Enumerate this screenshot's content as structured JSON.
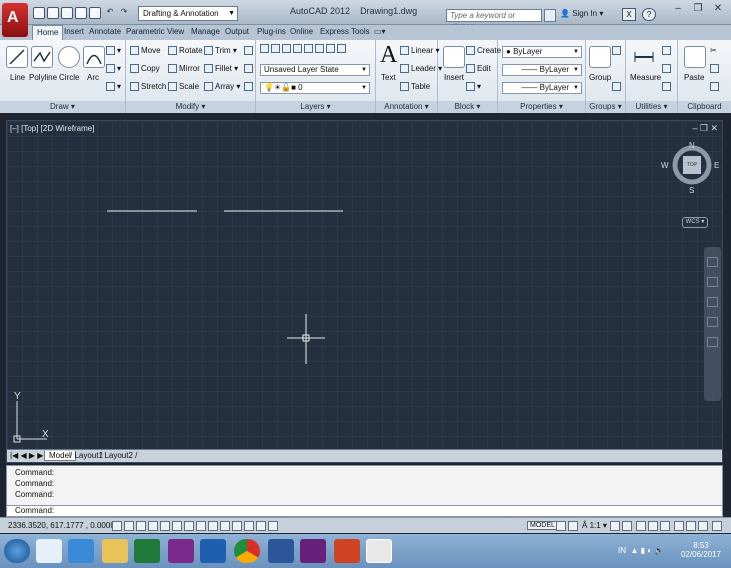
{
  "title_bar": {
    "workspace": "Drafting & Annotation",
    "app_title": "AutoCAD 2012",
    "file_name": "Drawing1.dwg",
    "search_placeholder": "Type a keyword or phrase",
    "sign_in": "Sign In"
  },
  "tabs": [
    "Home",
    "Insert",
    "Annotate",
    "Parametric",
    "View",
    "Manage",
    "Output",
    "Plug-ins",
    "Online",
    "Express Tools"
  ],
  "ribbon": {
    "draw": {
      "title": "Draw",
      "tools": [
        "Line",
        "Polyline",
        "Circle",
        "Arc"
      ]
    },
    "modify": {
      "title": "Modify",
      "col1": [
        "Move",
        "Copy",
        "Stretch"
      ],
      "col2": [
        "Rotate",
        "Mirror",
        "Scale"
      ],
      "col3": [
        "Trim",
        "Fillet",
        "Array"
      ]
    },
    "layers": {
      "title": "Layers",
      "state": "Unsaved Layer State",
      "current_layer": "0"
    },
    "annotation": {
      "title": "Annotation",
      "big": "Text",
      "items": [
        "Linear",
        "Leader",
        "Table"
      ]
    },
    "block": {
      "title": "Block",
      "big": "Insert",
      "items": [
        "Create",
        "Edit"
      ]
    },
    "properties": {
      "title": "Properties",
      "values": [
        "ByLayer",
        "ByLayer",
        "ByLayer"
      ]
    },
    "groups": {
      "title": "Groups",
      "big": "Group"
    },
    "utilities": {
      "title": "Utilities",
      "big": "Measure"
    },
    "clipboard": {
      "title": "Clipboard",
      "big": "Paste"
    }
  },
  "viewport": {
    "label": "[–] [Top] [2D Wireframe]",
    "viewcube": {
      "top": "TOP",
      "n": "N",
      "s": "S",
      "e": "E",
      "w": "W",
      "wcs": "WCS"
    },
    "ucs": {
      "x": "X",
      "y": "Y"
    }
  },
  "layout_tabs": [
    "Model",
    "Layout1",
    "Layout2"
  ],
  "command": {
    "history": [
      "Command:",
      "Command:",
      "Command:"
    ],
    "prompt": "Command:"
  },
  "status": {
    "coordinates": "2336.3520, 617.1777 , 0.0000",
    "model": "MODEL",
    "scale": "1:1"
  },
  "clock": {
    "time": "8:53",
    "date": "02/06/2017"
  },
  "tray": {
    "lang": "IN"
  }
}
